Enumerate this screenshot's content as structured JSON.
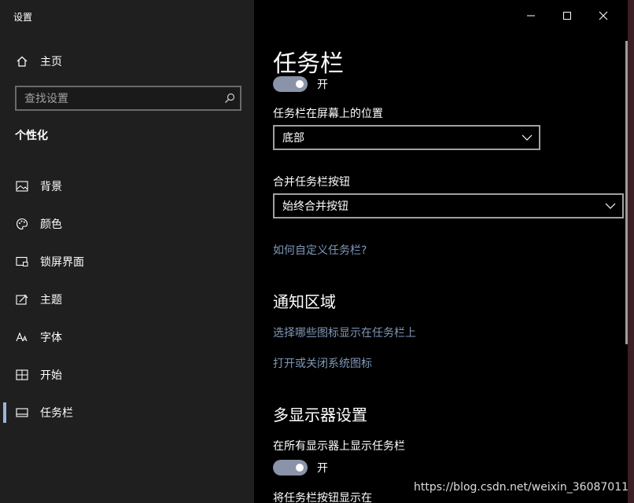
{
  "window": {
    "app_title": "设置",
    "controls": [
      "minimize-icon",
      "maximize-icon",
      "close-icon"
    ]
  },
  "sidebar": {
    "home_label": "主页",
    "search_placeholder": "查找设置",
    "section_title": "个性化",
    "items": [
      {
        "label": "背景",
        "icon": "picture-icon"
      },
      {
        "label": "颜色",
        "icon": "palette-icon"
      },
      {
        "label": "锁屏界面",
        "icon": "lock-screen-icon"
      },
      {
        "label": "主题",
        "icon": "theme-icon"
      },
      {
        "label": "字体",
        "icon": "font-icon"
      },
      {
        "label": "开始",
        "icon": "start-icon"
      },
      {
        "label": "任务栏",
        "icon": "taskbar-icon",
        "active": true
      }
    ]
  },
  "main": {
    "title": "任务栏",
    "toggle1_state": "开",
    "position_label": "任务栏在屏幕上的位置",
    "position_value": "底部",
    "combine_label": "合并任务栏按钮",
    "combine_value": "始终合并按钮",
    "customize_link": "如何自定义任务栏?",
    "notify_heading": "通知区域",
    "notify_link1": "选择哪些图标显示在任务栏上",
    "notify_link2": "打开或关闭系统图标",
    "multi_heading": "多显示器设置",
    "multi_label": "在所有显示器上显示任务栏",
    "toggle2_state": "开",
    "multi_label2": "将任务栏按钮显示在"
  },
  "watermark": "https://blog.csdn.net/weixin_36087011",
  "colors": {
    "sidebar_bg": "#1f1f1f",
    "main_bg": "#000000",
    "accent_link": "#7f98b8",
    "toggle_track": "#8a93a8",
    "active_indicator": "#9bb4d8"
  }
}
